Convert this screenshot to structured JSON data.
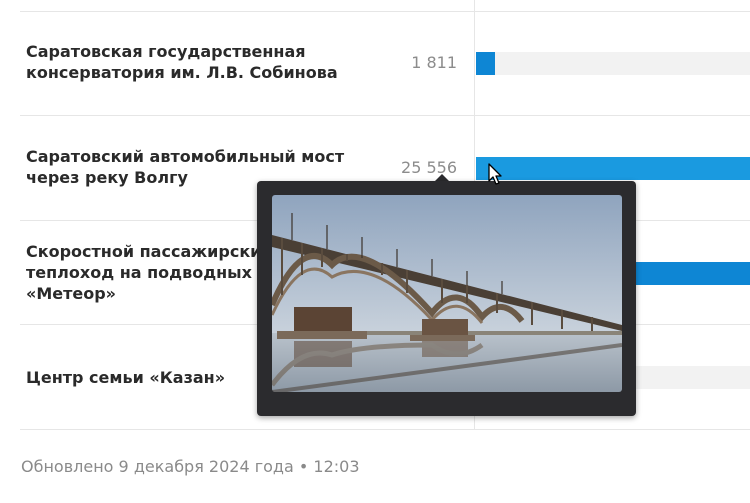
{
  "rows": [
    {
      "name_line1": "Саратовская государственная",
      "name_line2": "консерватория им. Л.В. Собинова",
      "name_line3": "",
      "count": "1 811",
      "bar_fraction": 0.07,
      "bar_color": "#0e86d4"
    },
    {
      "name_line1": "Саратовский автомобильный мост",
      "name_line2": "через реку Волгу",
      "name_line3": "",
      "count": "25 556",
      "bar_fraction": 1.0,
      "bar_color": "#1a9ae0"
    },
    {
      "name_line1": "Скоростной пассажирский",
      "name_line2": "теплоход на подводных крыльях",
      "name_line3": "«Метеор»",
      "count": "",
      "bar_fraction": 1.0,
      "bar_color": "#0e86d4"
    },
    {
      "name_line1": "Центр семьи «Казан»",
      "name_line2": "",
      "name_line3": "",
      "count": "",
      "bar_fraction": 0.0,
      "bar_color": "#0e86d4"
    }
  ],
  "footer": {
    "updated": "Обновлено 9 декабря 2024 года • 12:03"
  },
  "popup": {
    "image_icon": "bridge-photo"
  },
  "colors": {
    "accent": "#0e86d4",
    "popup_bg": "#2b2b2e"
  }
}
